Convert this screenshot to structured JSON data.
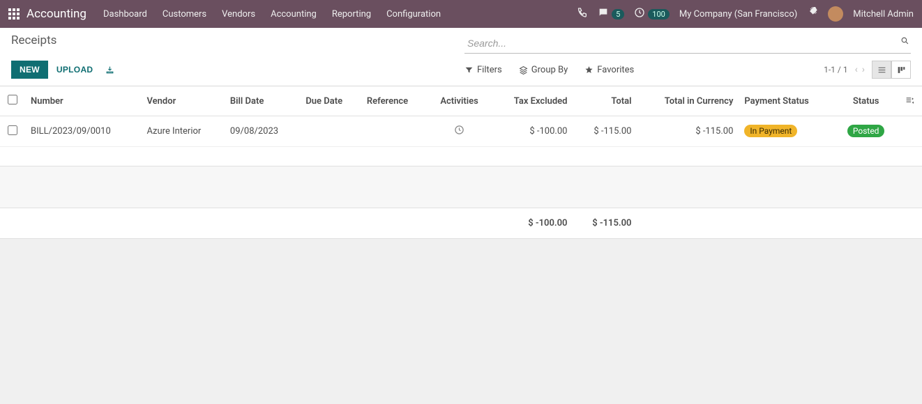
{
  "nav": {
    "brand": "Accounting",
    "items": [
      "Dashboard",
      "Customers",
      "Vendors",
      "Accounting",
      "Reporting",
      "Configuration"
    ],
    "msg_count": "5",
    "timer_count": "100",
    "company": "My Company (San Francisco)",
    "user": "Mitchell Admin"
  },
  "page": {
    "title": "Receipts",
    "search_placeholder": "Search...",
    "new_label": "NEW",
    "upload_label": "UPLOAD",
    "filters_label": "Filters",
    "groupby_label": "Group By",
    "favorites_label": "Favorites",
    "pager": "1-1 / 1"
  },
  "table": {
    "headers": {
      "number": "Number",
      "vendor": "Vendor",
      "billdate": "Bill Date",
      "duedate": "Due Date",
      "reference": "Reference",
      "activities": "Activities",
      "tax": "Tax Excluded",
      "total": "Total",
      "total_currency": "Total in Currency",
      "payment_status": "Payment Status",
      "status": "Status"
    },
    "rows": [
      {
        "number": "BILL/2023/09/0010",
        "vendor": "Azure Interior",
        "billdate": "09/08/2023",
        "duedate": "",
        "reference": "",
        "tax": "$ -100.00",
        "total": "$ -115.00",
        "total_currency": "$ -115.00",
        "payment_status": "In Payment",
        "status": "Posted"
      }
    ],
    "totals": {
      "tax": "$ -100.00",
      "total": "$ -115.00"
    }
  }
}
